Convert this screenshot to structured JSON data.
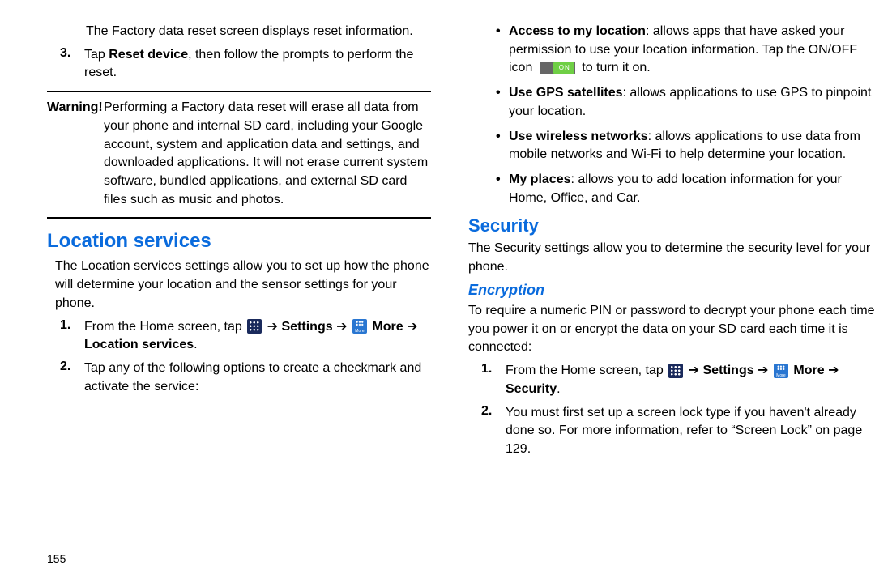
{
  "page_number": "155",
  "left": {
    "factory_line": "The Factory data reset screen displays reset information.",
    "step3_num": "3.",
    "step3_a": "Tap ",
    "step3_b": "Reset device",
    "step3_c": ", then follow the prompts to perform the reset.",
    "warn_label": "Warning!",
    "warn_text": "Performing a Factory data reset will erase all data from your phone and internal SD card, including your Google account, system and application data and settings, and downloaded applications. It will not erase current system software, bundled applications, and external SD card files such as music and photos.",
    "h_loc": "Location services",
    "loc_intro": "The Location services settings allow you to set up how the phone will determine your location and the sensor settings for your phone.",
    "s1_num": "1.",
    "s1_a": "From the Home screen, tap ",
    "s1_settings": "Settings",
    "s1_arrow1": " ➔ ",
    "s1_more": "More",
    "s1_arrow2": " ➔ ",
    "s1_locserv": "Location services",
    "s1_dot": ".",
    "s2_num": "2.",
    "s2_text": "Tap any of the following options to create a checkmark and activate the service:"
  },
  "right": {
    "b1_t": "Access to my location",
    "b1_a": ": allows apps that have asked your permission to use your location information. Tap the ON/OFF icon ",
    "b1_b": " to turn it on.",
    "b2_t": "Use GPS satellites",
    "b2_a": ": allows applications to use GPS to pinpoint your location.",
    "b3_t": "Use wireless networks",
    "b3_a": ": allows applications to use data from mobile networks and Wi-Fi to help determine your location.",
    "b4_t": "My places",
    "b4_a": ": allows you to add location information for your Home, Office, and Car.",
    "h_sec": "Security",
    "sec_intro": "The Security settings allow you to determine the security level for your phone.",
    "h_enc": "Encryption",
    "enc_intro": "To require a numeric PIN or password to decrypt your phone each time you power it on or encrypt the data on your SD card each time it is connected:",
    "e1_num": "1.",
    "e1_a": "From the Home screen, tap ",
    "e1_settings": "Settings",
    "e1_arrow1": " ➔ ",
    "e1_more": "More",
    "e1_arrow2": " ➔ ",
    "e1_security": "Security",
    "e1_dot": ".",
    "e2_num": "2.",
    "e2_a": "You must first set up a screen lock type if you haven't already done so. For more information, refer to ",
    "e2_ref": "“Screen Lock”",
    "e2_b": " on page 129."
  }
}
